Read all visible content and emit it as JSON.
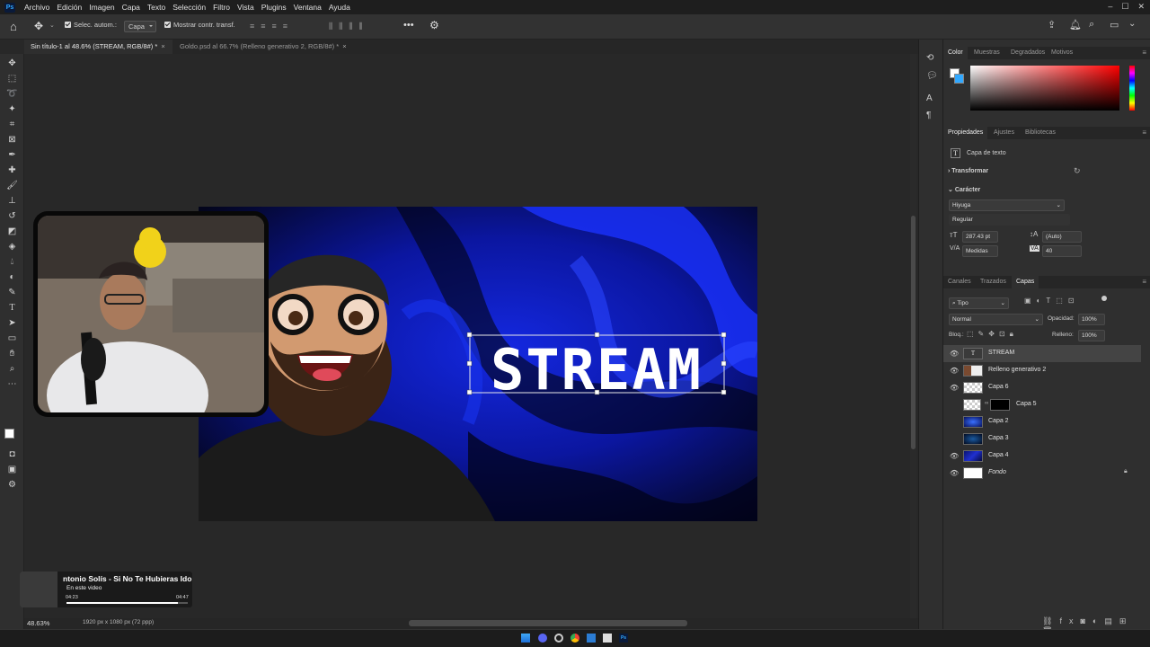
{
  "menubar": {
    "app_icon": "Ps",
    "items": [
      "Archivo",
      "Edición",
      "Imagen",
      "Capa",
      "Texto",
      "Selección",
      "Filtro",
      "Vista",
      "Plugins",
      "Ventana",
      "Ayuda"
    ]
  },
  "options": {
    "auto_select_label": "Selec. autom.:",
    "auto_select_value": "Capa",
    "transform_label": "Mostrar contr. transf."
  },
  "tabs": [
    {
      "label": "Sin título-1 al 48.6% (STREAM, RGB/8#) *",
      "close": "×"
    },
    {
      "label": "Goldo.psd al 66.7% (Relleno generativo 2, RGB/8#) *",
      "close": "×"
    }
  ],
  "canvas": {
    "stream_text": "STREAM"
  },
  "status": {
    "zoom": "48.63%",
    "doc_info": "1920 px x 1080 px (72 ppp)"
  },
  "video_popup": {
    "title": "ntonio Solís - Si No Te Hubieras Ido",
    "subtitle": "En este video",
    "time_current": "04:23",
    "time_total": "04:47",
    "progress": 0.92
  },
  "color_panel": {
    "tabs": [
      "Color",
      "Muestras",
      "Degradados",
      "Motivos"
    ],
    "active_tab": "Color",
    "hue_color": "#ff0000"
  },
  "properties": {
    "tabs": [
      "Propiedades",
      "Ajustes",
      "Bibliotecas"
    ],
    "layer_kind": "Capa de texto",
    "transform_label": "Transformar",
    "character_label": "Carácter",
    "font": "Hiyuga",
    "style": "Regular",
    "size": "287.43 pt",
    "leading": "(Auto)",
    "kerning": "Medidas",
    "tracking": "40"
  },
  "layers_panel": {
    "tabs": [
      "Canales",
      "Trazados",
      "Capas"
    ],
    "filter_label": "Tipo",
    "blend_mode": "Normal",
    "opacity_label": "Opacidad:",
    "opacity": "100%",
    "lock_label": "Bloq.:",
    "fill_label": "Relleno:",
    "fill": "100%",
    "layers": [
      {
        "name": "STREAM",
        "visible": true,
        "kind": "text"
      },
      {
        "name": "Relleno generativo 2",
        "visible": true,
        "kind": "gen"
      },
      {
        "name": "Capa 6",
        "visible": true,
        "kind": "empty"
      },
      {
        "name": "Capa 5",
        "visible": false,
        "kind": "mask"
      },
      {
        "name": "Capa 2",
        "visible": false,
        "kind": "blue"
      },
      {
        "name": "Capa 3",
        "visible": false,
        "kind": "dark"
      },
      {
        "name": "Capa 4",
        "visible": true,
        "kind": "blue2"
      },
      {
        "name": "Fondo",
        "visible": true,
        "kind": "white"
      }
    ]
  },
  "colors": {
    "accent": "#31a8ff",
    "canvas_blue": "#1020d8"
  }
}
